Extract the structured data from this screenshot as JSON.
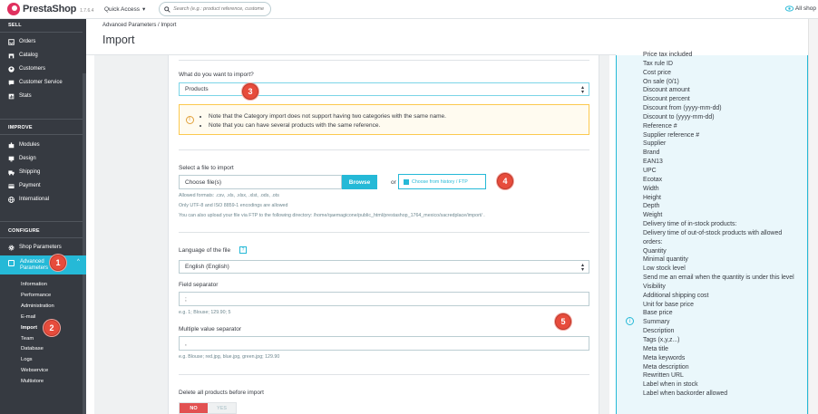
{
  "topbar": {
    "logo_text": "PrestaShop",
    "version": "1.7.6.4",
    "quick_access": "Quick Access",
    "search_placeholder": "Search (e.g.: product reference, custome",
    "all_shops": "All shop"
  },
  "sidebar": {
    "sections": [
      {
        "title": "SELL",
        "items": [
          "Orders",
          "Catalog",
          "Customers",
          "Customer Service",
          "Stats"
        ]
      },
      {
        "title": "IMPROVE",
        "items": [
          "Modules",
          "Design",
          "Shipping",
          "Payment",
          "International"
        ]
      },
      {
        "title": "CONFIGURE",
        "items": [
          "Shop Parameters",
          "Advanced Parameters"
        ]
      }
    ],
    "adv_line1": "Advanced",
    "adv_line2": "Parameters",
    "sub_items": [
      "Information",
      "Performance",
      "Administration",
      "E-mail",
      "Import",
      "Team",
      "Database",
      "Logs",
      "Webservice",
      "Multistore"
    ],
    "active_sub": "Import"
  },
  "header": {
    "breadcrumb": "Advanced Parameters  /  Import",
    "title": "Import"
  },
  "form": {
    "what_label": "What do you want to import?",
    "what_value": "Products",
    "alert_items": [
      "Note that the Category import does not support having two categories with the same name.",
      "Note that you can have several products with the same reference."
    ],
    "file_label": "Select a file to import",
    "file_placeholder": "Choose file(s)",
    "browse_label": "Browse",
    "or_label": "or",
    "history_label": "Choose from history / FTP",
    "help_formats": "Allowed formats: .csv, .xls, .xlsx, .xlst, .ods, .ots",
    "help_encoding": "Only UTF-8 and ISO 8859-1 encodings are allowed",
    "help_ftp": "You can also upload your file via FTP to the following directory: /home/qaemagicone/public_html/prestashop_1764_mexico/sacredplace/import/ .",
    "lang_label": "Language of the file",
    "lang_value": "English (English)",
    "field_sep_label": "Field separator",
    "field_sep_value": ";",
    "field_sep_help": "e.g. 1; Blouse; 129.90; 5",
    "multi_sep_label": "Multiple value separator",
    "multi_sep_value": ",",
    "multi_sep_help": "e.g. Blouse; red.jpg, blue.jpg, green.jpg; 129.90",
    "delete_label": "Delete all products before import",
    "toggle_no": "NO",
    "toggle_yes": "YES"
  },
  "fields_list": [
    "Price tax included",
    "Tax rule ID",
    "Cost price",
    "On sale (0/1)",
    "Discount amount",
    "Discount percent",
    "Discount from (yyyy-mm-dd)",
    "Discount to (yyyy-mm-dd)",
    "Reference #",
    "Supplier reference #",
    "Supplier",
    "Brand",
    "EAN13",
    "UPC",
    "Ecotax",
    "Width",
    "Height",
    "Depth",
    "Weight",
    "Delivery time of in-stock products:",
    "Delivery time of out-of-stock products with allowed",
    "orders:",
    "Quantity",
    "Minimal quantity",
    "Low stock level",
    "Send me an email when the quantity is under this level",
    "Visibility",
    "Additional shipping cost",
    "Unit for base price",
    "Base price",
    "Summary",
    "Description",
    "Tags (x,y,z...)",
    "Meta title",
    "Meta keywords",
    "Meta description",
    "Rewritten URL",
    "Label when in stock",
    "Label when backorder allowed"
  ],
  "badges": [
    "1",
    "2",
    "3",
    "4",
    "5"
  ],
  "colors": {
    "accent": "#25b9d7",
    "sidebar": "#363a41",
    "badge": "#e74c3c",
    "warning": "#fcc94f"
  }
}
